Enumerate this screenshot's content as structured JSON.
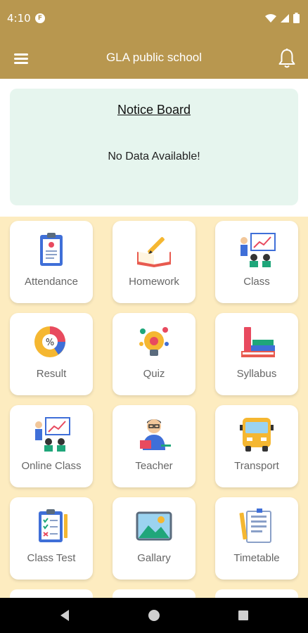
{
  "status_bar": {
    "time": "4:10",
    "app_icon_letter": "F"
  },
  "app_bar": {
    "title": "GLA public school"
  },
  "notice_board": {
    "title": "Notice Board",
    "empty_message": "No Data Available!"
  },
  "tiles": [
    {
      "label": "Attendance",
      "icon": "attendance-icon"
    },
    {
      "label": "Homework",
      "icon": "homework-icon"
    },
    {
      "label": "Class",
      "icon": "class-icon"
    },
    {
      "label": "Result",
      "icon": "result-icon"
    },
    {
      "label": "Quiz",
      "icon": "quiz-icon"
    },
    {
      "label": "Syllabus",
      "icon": "syllabus-icon"
    },
    {
      "label": "Online Class",
      "icon": "online-class-icon"
    },
    {
      "label": "Teacher",
      "icon": "teacher-icon"
    },
    {
      "label": "Transport",
      "icon": "transport-icon"
    },
    {
      "label": "Class Test",
      "icon": "class-test-icon"
    },
    {
      "label": "Gallary",
      "icon": "gallery-icon"
    },
    {
      "label": "Timetable",
      "icon": "timetable-icon"
    }
  ],
  "colors": {
    "primary": "#b8974f",
    "grid_background": "#fdecc0",
    "notice_card": "#e6f5ee"
  }
}
